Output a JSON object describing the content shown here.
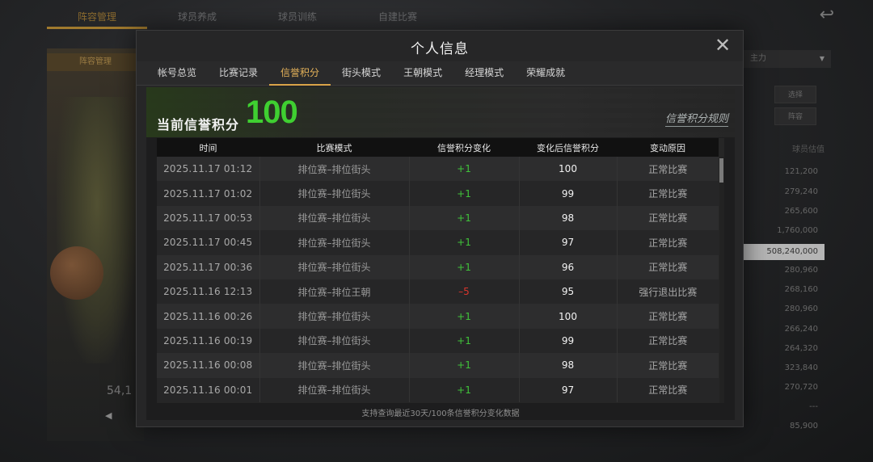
{
  "background": {
    "top_nav": [
      "阵容管理",
      "球员养成",
      "球员训练",
      "自建比赛"
    ],
    "left_tag": "阵容管理",
    "left_number": "54,1",
    "right_dropdown": "主力",
    "right_buttons": [
      "选择",
      "阵容"
    ],
    "right_label": "球员估值",
    "right_values": [
      "121,200",
      "279,240",
      "265,600",
      "1,760,000",
      "508,240,000",
      "280,960",
      "268,160",
      "280,960",
      "266,240",
      "264,320",
      "323,840",
      "270,720",
      "---",
      "85,900"
    ]
  },
  "modal": {
    "title": "个人信息",
    "close_symbol": "✕"
  },
  "tabs": [
    {
      "label": "帐号总览",
      "active": false
    },
    {
      "label": "比赛记录",
      "active": false
    },
    {
      "label": "信誉积分",
      "active": true
    },
    {
      "label": "街头模式",
      "active": false
    },
    {
      "label": "王朝模式",
      "active": false
    },
    {
      "label": "经理模式",
      "active": false
    },
    {
      "label": "荣耀成就",
      "active": false
    }
  ],
  "score": {
    "label": "当前信誉积分",
    "value": "100",
    "rules_link": "信誉积分规则"
  },
  "table": {
    "headers": [
      "时间",
      "比赛模式",
      "信誉积分变化",
      "变化后信誉积分",
      "变动原因"
    ],
    "rows": [
      {
        "time": "2025.11.17  01:12",
        "mode": "排位赛–排位街头",
        "delta": "+1",
        "after": "100",
        "reason": "正常比赛"
      },
      {
        "time": "2025.11.17  01:02",
        "mode": "排位赛–排位街头",
        "delta": "+1",
        "after": "99",
        "reason": "正常比赛"
      },
      {
        "time": "2025.11.17  00:53",
        "mode": "排位赛–排位街头",
        "delta": "+1",
        "after": "98",
        "reason": "正常比赛"
      },
      {
        "time": "2025.11.17  00:45",
        "mode": "排位赛–排位街头",
        "delta": "+1",
        "after": "97",
        "reason": "正常比赛"
      },
      {
        "time": "2025.11.17  00:36",
        "mode": "排位赛–排位街头",
        "delta": "+1",
        "after": "96",
        "reason": "正常比赛"
      },
      {
        "time": "2025.11.16  12:13",
        "mode": "排位赛–排位王朝",
        "delta": "–5",
        "after": "95",
        "reason": "强行退出比赛"
      },
      {
        "time": "2025.11.16  00:26",
        "mode": "排位赛–排位街头",
        "delta": "+1",
        "after": "100",
        "reason": "正常比赛"
      },
      {
        "time": "2025.11.16  00:19",
        "mode": "排位赛–排位街头",
        "delta": "+1",
        "after": "99",
        "reason": "正常比赛"
      },
      {
        "time": "2025.11.16  00:08",
        "mode": "排位赛–排位街头",
        "delta": "+1",
        "after": "98",
        "reason": "正常比赛"
      },
      {
        "time": "2025.11.16  00:01",
        "mode": "排位赛–排位街头",
        "delta": "+1",
        "after": "97",
        "reason": "正常比赛"
      }
    ]
  },
  "footer_note": "支持查询最近30天/100条信誉积分变化数据",
  "colors": {
    "accent": "#d9a348",
    "positive": "#40c23a",
    "negative": "#d9352d",
    "score": "#3fcf31"
  }
}
